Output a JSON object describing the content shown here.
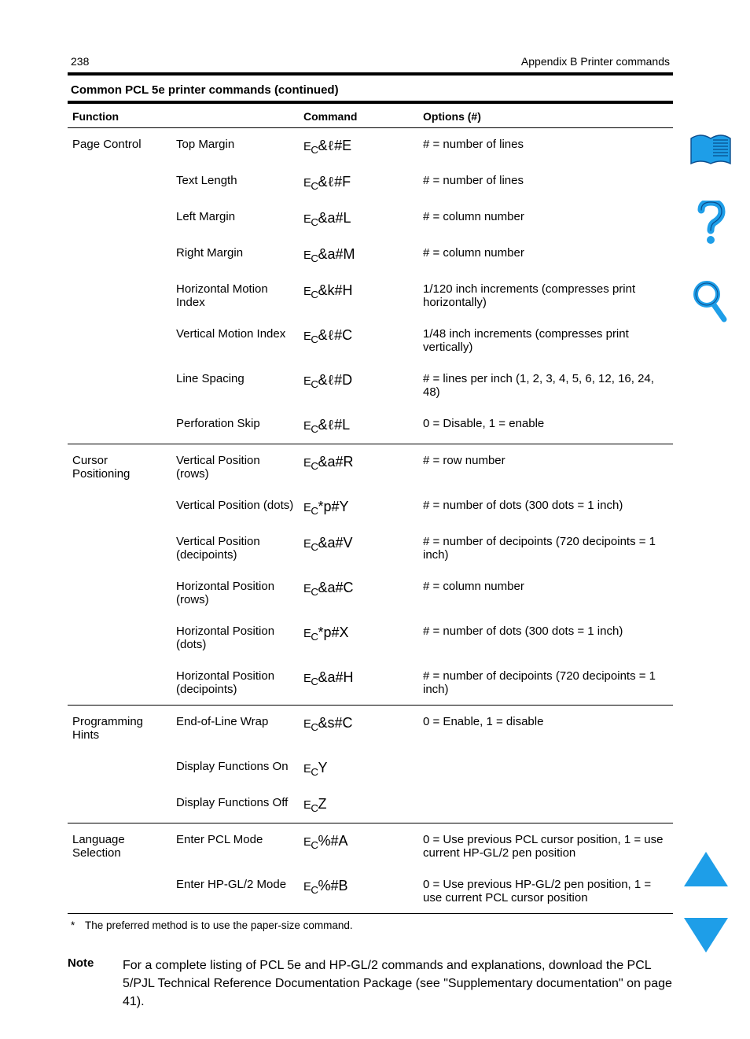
{
  "header": {
    "page_number": "238",
    "appendix_title": "Appendix B  Printer commands"
  },
  "columns": {
    "function": "Function",
    "command": "Command",
    "options": "Options (#)"
  },
  "sections": [
    {
      "title": "Page Control",
      "anchor": true,
      "rows": [
        {
          "func": "Top Margin",
          "cmd": [
            "Ec",
            "&",
            "ℓ",
            "#E"
          ],
          "opt": "# = number of lines"
        },
        {
          "func": "Text Length",
          "cmd": [
            "Ec",
            "&",
            "ℓ",
            "#F"
          ],
          "opt": "# = number of lines"
        },
        {
          "func": "Left Margin",
          "cmd": [
            "Ec",
            "&a#L"
          ],
          "opt": "# = column number"
        },
        {
          "func": "Right Margin",
          "cmd": [
            "Ec",
            "&a#M"
          ],
          "opt": "# = column number"
        },
        {
          "func": "Horizontal Motion Index",
          "cmd": [
            "Ec",
            "&k#H"
          ],
          "opt": "1/120 inch increments (compresses print horizontally)"
        },
        {
          "func": "Vertical Motion Index",
          "cmd": [
            "Ec",
            "&",
            "ℓ",
            "#C"
          ],
          "opt": "1/48 inch increments (compresses print vertically)"
        },
        {
          "func": "Line Spacing",
          "cmd": [
            "Ec",
            "&",
            "ℓ",
            "#D"
          ],
          "opt": "# = lines per inch (1, 2, 3, 4, 5, 6, 12, 16, 24, 48)"
        },
        {
          "func": "Perforation Skip",
          "cmd": [
            "Ec",
            "&",
            "ℓ",
            "#L"
          ],
          "opt": "0 = Disable, 1 = enable"
        }
      ]
    },
    {
      "title": "Cursor Positioning",
      "rows": [
        {
          "func": "Vertical Position (rows)",
          "cmd": [
            "Ec",
            "&a#R"
          ],
          "opt": "# = row number"
        },
        {
          "func": "Vertical Position (dots)",
          "cmd": [
            "Ec",
            "*p#Y"
          ],
          "opt": "# = number of dots (300 dots = 1 inch)"
        },
        {
          "func": "Vertical Position (decipoints)",
          "cmd": [
            "Ec",
            "&a#V"
          ],
          "opt": "# = number of decipoints (720 decipoints = 1 inch)"
        },
        {
          "func": "Horizontal Position (rows)",
          "cmd": [
            "Ec",
            "&a#C"
          ],
          "opt": "# = column number"
        },
        {
          "func": "Horizontal Position (dots)",
          "cmd": [
            "Ec",
            "*p#X"
          ],
          "opt": "# = number of dots (300 dots = 1 inch)"
        },
        {
          "func": "Horizontal Position (decipoints)",
          "cmd": [
            "Ec",
            "&a#H"
          ],
          "opt": "# = number of decipoints (720 decipoints = 1 inch)"
        }
      ]
    },
    {
      "title": "Programming Hints",
      "rows": [
        {
          "func": "End-of-Line Wrap",
          "cmd": [
            "Ec",
            "&s#C"
          ],
          "opt": "0 = Enable, 1 = disable"
        },
        {
          "func": "Display Functions On",
          "cmd": [
            "Ec",
            "Y"
          ],
          "opt": ""
        },
        {
          "func": "Display Functions Off",
          "cmd": [
            "Ec",
            "Z"
          ],
          "opt": ""
        }
      ]
    },
    {
      "title": "Language Selection",
      "rows": [
        {
          "func": "Enter PCL Mode",
          "cmd": [
            "Ec",
            "%#A"
          ],
          "opt": "0 = Use previous PCL cursor position, 1 = use current HP-GL/2 pen position"
        },
        {
          "func": "Enter HP-GL/2 Mode",
          "cmd": [
            "Ec",
            "%#B"
          ],
          "opt": "0 = Use previous HP-GL/2 pen position, 1 = use current PCL cursor position"
        }
      ]
    }
  ],
  "footnote": {
    "marker": "*",
    "text": "The preferred method is to use the paper-size command."
  },
  "note": {
    "label": "Note",
    "body": "For a complete listing of PCL 5e and HP-GL/2 commands and explanations, download the PCL 5/PJL Technical Reference Documentation Package (see \"Supplementary documentation\" on page 41)."
  },
  "table_caption": "Common PCL 5e printer commands (continued)",
  "icons": {
    "contents": "contents-icon",
    "help": "help-icon",
    "search": "search-icon",
    "prev": "previous-page",
    "next": "next-page"
  }
}
